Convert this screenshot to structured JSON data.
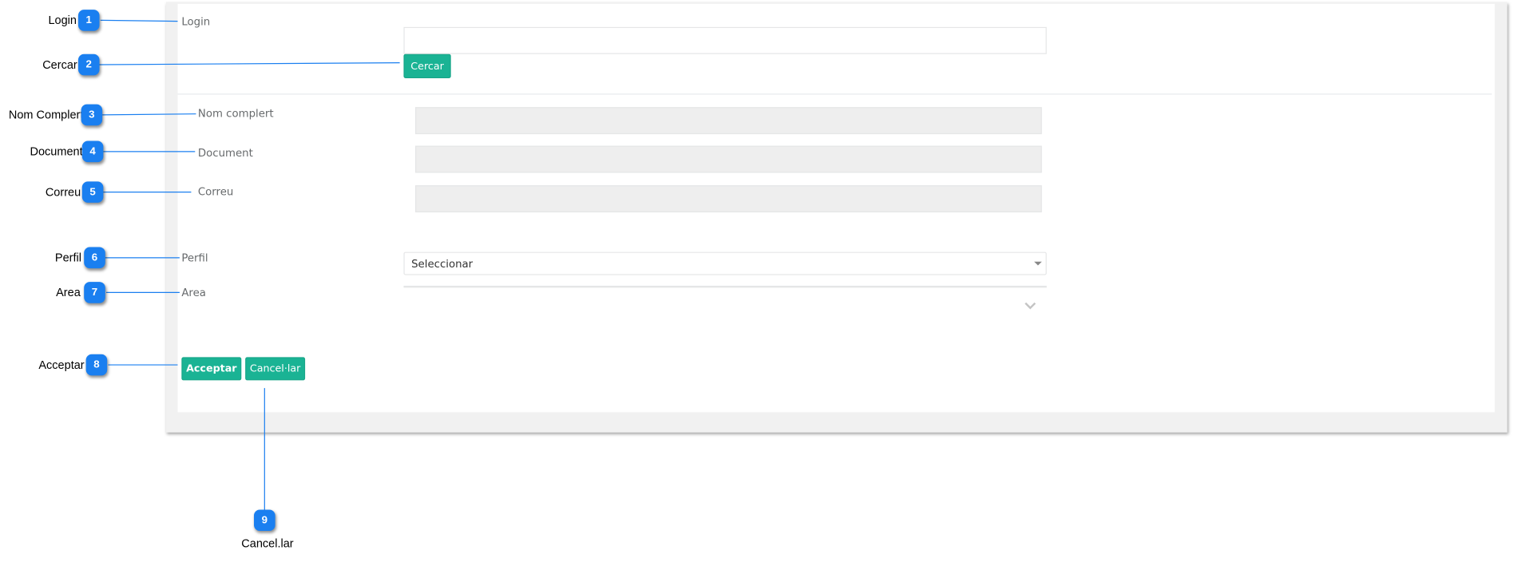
{
  "form": {
    "login_label": "Login",
    "search_button": "Cercar",
    "fullname_label": "Nom complert",
    "document_label": "Document",
    "email_label": "Correu",
    "profile_label": "Perfil",
    "profile_select_value": "Seleccionar",
    "area_label": "Area",
    "accept_button": "Acceptar",
    "cancel_button": "Cancel·lar"
  },
  "callouts": [
    {
      "number": "1",
      "label": "Login"
    },
    {
      "number": "2",
      "label": "Cercar"
    },
    {
      "number": "3",
      "label": "Nom Complert"
    },
    {
      "number": "4",
      "label": "Document"
    },
    {
      "number": "5",
      "label": "Correu"
    },
    {
      "number": "6",
      "label": "Perfil"
    },
    {
      "number": "7",
      "label": "Area"
    },
    {
      "number": "8",
      "label": "Acceptar"
    },
    {
      "number": "9",
      "label": "Cancel.lar"
    }
  ],
  "colors": {
    "accent_green": "#1ab394",
    "callout_blue": "#1a7ff0",
    "label_gray": "#676a6c"
  },
  "icons": [
    "chevron-down-icon",
    "caret-down-icon"
  ]
}
